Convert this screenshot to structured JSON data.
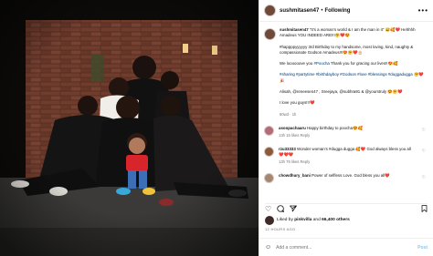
{
  "header": {
    "username": "sushmitasen47",
    "separator": "•",
    "follow_label": "Following",
    "more_label": "•••"
  },
  "caption": {
    "username": "sushmitasen47",
    "line1": " “It’s a woman’s world & I am the man in it” 😅🥰❤️ Hehhhh Amadeus YOU INDEED ARE!!!🤗❤️😍",
    "line2": "#happppyyyyyy 3rd Birthday to my handsome, most loving, kind, naughty & compassionate Godson Amadeus!!!😍🤗❤️🎂",
    "line3": "We loooooove you ",
    "line3_tag": "#Poocha",
    "line3_end": " Thank you for gracing our lives!!😍🥰",
    "hashtags": "#sharing #partytime #birthdayboy #Godson #love #blessings #duggadugga 🤗❤️🎉",
    "mentions": "Alisah, @reneesen47 , Sreejaya, @subhra91 & @yourstruly 😍🤗❤️",
    "closing": "I love you guys!!!❤️",
    "meta": "60wd · 1h"
  },
  "comments": [
    {
      "username": "asoopachaaru",
      "text": " Happy birthday to poocha😍🥰",
      "meta": "13h   15 likes   Reply"
    },
    {
      "username": "rzu33333",
      "text": " Wonder woman’s #dugga dugga 🥰❤️ God always bless you all❤️❤️❤️",
      "meta": "13h   76 likes   Reply"
    },
    {
      "username": "chowdhury_bani",
      "text": " Power of selfless Love. God bless you all❤️",
      "meta": ""
    }
  ],
  "actions": {
    "like_icon": "heart-icon",
    "comment_icon": "comment-icon",
    "share_icon": "share-icon",
    "save_icon": "bookmark-icon"
  },
  "likes": {
    "prefix": "Liked by ",
    "user": "pinkvilla",
    "middle": " and ",
    "count": "66,400 others"
  },
  "date": "12 HOURS AGO",
  "add_comment": {
    "emoji_icon": "smiley-icon",
    "placeholder": "Add a comment...",
    "post_label": "Post"
  }
}
